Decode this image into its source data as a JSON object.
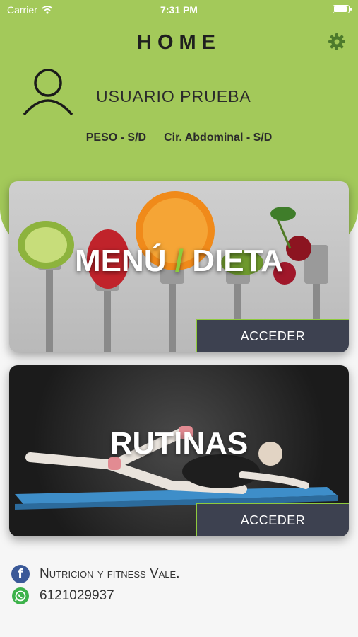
{
  "status_bar": {
    "carrier": "Carrier",
    "time": "7:31 PM"
  },
  "header": {
    "title": "HOME",
    "settings_icon": "gear-icon"
  },
  "user": {
    "name": "USUARIO PRUEBA",
    "weight": "PESO - S/D",
    "waist": "Cir. Abdominal - S/D"
  },
  "cards": {
    "menu": {
      "title_left": "MENÚ",
      "title_slash": "/",
      "title_right": "DIETA",
      "action": "ACCEDER"
    },
    "rutinas": {
      "title": "RUTINAS",
      "action": "ACCEDER"
    }
  },
  "footer": {
    "facebook": "Nutricion y fitness Vale.",
    "phone": "6121029937"
  },
  "colors": {
    "accent": "#a3c95a",
    "button": "#3d4150",
    "button_border": "#8fca3e"
  }
}
